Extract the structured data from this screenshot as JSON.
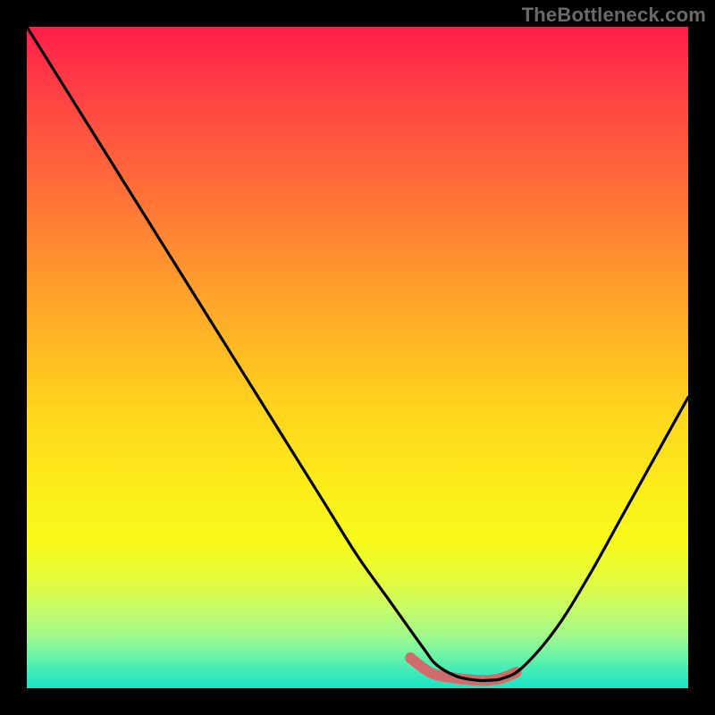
{
  "watermark": "TheBottleneck.com",
  "chart_data": {
    "type": "line",
    "title": "",
    "xlabel": "",
    "ylabel": "",
    "xlim": [
      0,
      100
    ],
    "ylim": [
      0,
      100
    ],
    "grid": false,
    "legend": false,
    "series": [
      {
        "name": "bottleneck-curve",
        "x": [
          0,
          5,
          10,
          15,
          20,
          25,
          30,
          35,
          40,
          45,
          50,
          55,
          60,
          62,
          65,
          68,
          70,
          72,
          75,
          80,
          85,
          90,
          95,
          100
        ],
        "y": [
          100,
          92,
          84,
          76,
          68,
          60,
          52,
          44,
          36,
          28,
          20,
          13,
          6,
          3.5,
          1.8,
          1.2,
          1.2,
          1.5,
          3.2,
          9,
          17,
          26,
          35,
          44
        ]
      }
    ],
    "highlight_segment": {
      "name": "valley",
      "x": [
        58,
        60,
        62,
        65,
        68,
        70,
        72,
        74
      ],
      "y": [
        4.6,
        3.0,
        2.0,
        1.5,
        1.2,
        1.2,
        1.6,
        2.4
      ],
      "color": "#d16b6c"
    },
    "background_gradient_stops": [
      {
        "pos": 0.0,
        "color": "#ff1e48"
      },
      {
        "pos": 0.18,
        "color": "#ff5a3e"
      },
      {
        "pos": 0.38,
        "color": "#ff9a2d"
      },
      {
        "pos": 0.58,
        "color": "#ffd51d"
      },
      {
        "pos": 0.78,
        "color": "#f7fa1a"
      },
      {
        "pos": 0.92,
        "color": "#9ff98c"
      },
      {
        "pos": 1.0,
        "color": "#18e4c7"
      }
    ]
  }
}
